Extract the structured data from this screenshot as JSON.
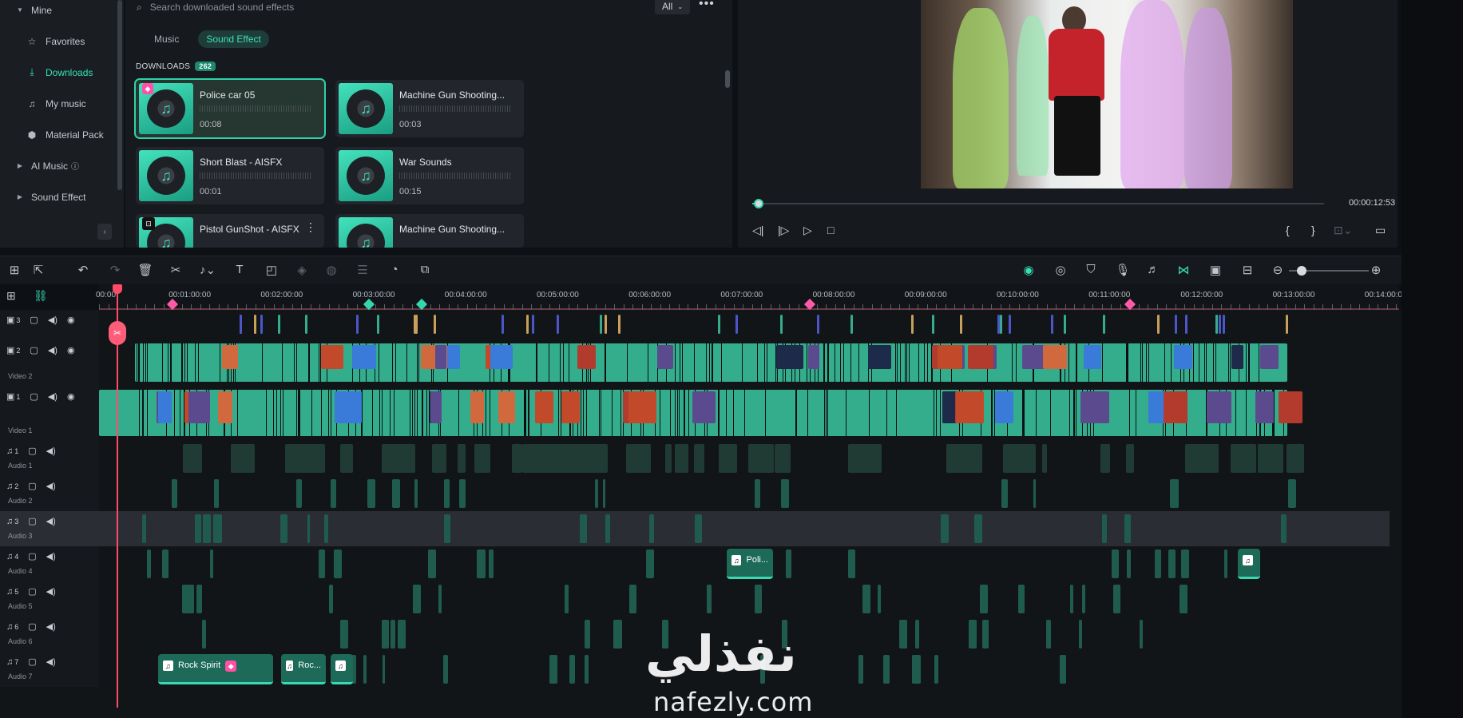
{
  "sidebar": {
    "items": [
      {
        "label": "Mine",
        "type": "group"
      },
      {
        "label": "Favorites",
        "icon": "star-icon"
      },
      {
        "label": "Downloads",
        "icon": "download-icon",
        "active": true
      },
      {
        "label": "My music",
        "icon": "music-note-icon"
      },
      {
        "label": "Material Pack",
        "icon": "package-icon"
      },
      {
        "label": "AI Music",
        "type": "group"
      },
      {
        "label": "Sound Effect",
        "type": "group"
      }
    ]
  },
  "library": {
    "search_placeholder": "Search downloaded sound effects",
    "filter_value": "All",
    "tabs": [
      "Music",
      "Sound Effect"
    ],
    "active_tab": "Sound Effect",
    "downloads_label": "DOWNLOADS",
    "downloads_count": "262",
    "cards": [
      {
        "title": "Police car 05",
        "duration": "00:08",
        "selected": true,
        "premium": true
      },
      {
        "title": "Machine Gun Shooting...",
        "duration": "00:03"
      },
      {
        "title": "Short Blast - AISFX",
        "duration": "00:01"
      },
      {
        "title": "War Sounds",
        "duration": "00:15"
      },
      {
        "title": "Pistol GunShot - AISFX",
        "duration": "",
        "ai": true
      },
      {
        "title": "Machine Gun Shooting...",
        "duration": ""
      }
    ]
  },
  "preview": {
    "timecode": "00:00:12:53",
    "progress_fraction": 0.017
  },
  "ruler": {
    "labels": [
      "00:00",
      "00:01:00:00",
      "00:02:00:00",
      "00:03:00:00",
      "00:04:00:00",
      "00:05:00:00",
      "00:06:00:00",
      "00:07:00:00",
      "00:08:00:00",
      "00:09:00:00",
      "00:10:00:00",
      "00:11:00:00",
      "00:12:00:00",
      "00:13:00:00",
      "00:14:00:00"
    ]
  },
  "tracks": [
    {
      "num": "3",
      "name": ""
    },
    {
      "num": "2",
      "name": "Video 2"
    },
    {
      "num": "1",
      "name": "Video 1"
    },
    {
      "num": "1",
      "name": "Audio 1"
    },
    {
      "num": "2",
      "name": "Audio 2"
    },
    {
      "num": "3",
      "name": "Audio 3"
    },
    {
      "num": "4",
      "name": "Audio 4"
    },
    {
      "num": "5",
      "name": "Audio 5"
    },
    {
      "num": "6",
      "name": "Audio 6"
    },
    {
      "num": "7",
      "name": "Audio 7"
    }
  ],
  "audio_labels": {
    "poli": "Poli...",
    "rock_spirit": "Rock Spirit",
    "roc": "Roc..."
  },
  "watermark": {
    "arabic": "نفذلي",
    "url": "nafezly.com"
  },
  "colors": {
    "accent": "#35e2b6",
    "playhead": "#ff4a6a",
    "clip": "#34ad8c"
  }
}
